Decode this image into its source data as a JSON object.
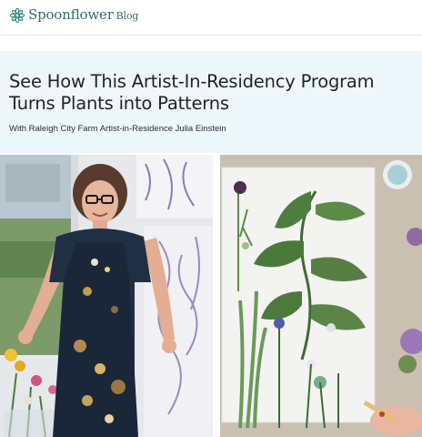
{
  "header": {
    "brand": "Spoonflower",
    "brand_suffix": "Blog",
    "logo_icon": "spoonflower-flower-icon"
  },
  "article": {
    "title_line1": "See How This Artist-In-Residency Program",
    "title_line2": "Turns Plants into Patterns",
    "subtitle": "With Raleigh City Farm Artist-in-Residence Julia Einstein"
  },
  "images": {
    "left": "artist-portrait-photo",
    "right": "plant-specimens-photo"
  },
  "colors": {
    "brand": "#2f6f6c",
    "hero_background": "#eef7fb",
    "title_text": "#1f2224"
  }
}
